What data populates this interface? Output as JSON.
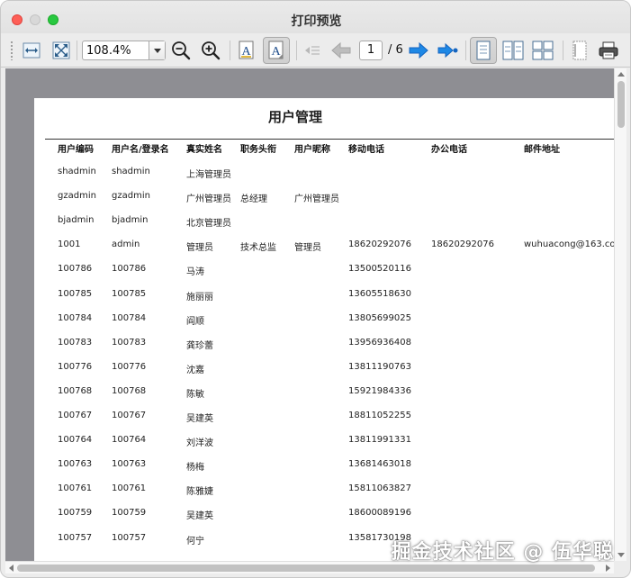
{
  "window": {
    "title": "打印预览"
  },
  "toolbar": {
    "zoom_value": "108.4%",
    "current_page": "1",
    "total_pages": "/ 6"
  },
  "document": {
    "title": "用户管理",
    "columns": [
      "用户编码",
      "用户名/登录名",
      "真实姓名",
      "职务头衔",
      "用户昵称",
      "移动电话",
      "办公电话",
      "邮件地址"
    ],
    "rows": [
      [
        "shadmin",
        "shadmin",
        "上海管理员",
        "",
        "",
        "",
        "",
        ""
      ],
      [
        "gzadmin",
        "gzadmin",
        "广州管理员",
        "总经理",
        "广州管理员",
        "",
        "",
        ""
      ],
      [
        "bjadmin",
        "bjadmin",
        "北京管理员",
        "",
        "",
        "",
        "",
        ""
      ],
      [
        "1001",
        "admin",
        "管理员",
        "技术总监",
        "管理员",
        "18620292076",
        "18620292076",
        "wuhuacong@163.co"
      ],
      [
        "100786",
        "100786",
        "马涛",
        "",
        "",
        "13500520116",
        "",
        ""
      ],
      [
        "100785",
        "100785",
        "施丽丽",
        "",
        "",
        "13605518630",
        "",
        ""
      ],
      [
        "100784",
        "100784",
        "阎顺",
        "",
        "",
        "13805699025",
        "",
        ""
      ],
      [
        "100783",
        "100783",
        "龚珍蕾",
        "",
        "",
        "13956936408",
        "",
        ""
      ],
      [
        "100776",
        "100776",
        "沈嘉",
        "",
        "",
        "13811190763",
        "",
        ""
      ],
      [
        "100768",
        "100768",
        "陈敏",
        "",
        "",
        "15921984336",
        "",
        ""
      ],
      [
        "100767",
        "100767",
        "吴建英",
        "",
        "",
        "18811052255",
        "",
        ""
      ],
      [
        "100764",
        "100764",
        "刘洋波",
        "",
        "",
        "13811991331",
        "",
        ""
      ],
      [
        "100763",
        "100763",
        "杨梅",
        "",
        "",
        "13681463018",
        "",
        ""
      ],
      [
        "100761",
        "100761",
        "陈雅婕",
        "",
        "",
        "15811063827",
        "",
        ""
      ],
      [
        "100759",
        "100759",
        "吴建英",
        "",
        "",
        "18600089196",
        "",
        ""
      ],
      [
        "100757",
        "100757",
        "何宁",
        "",
        "",
        "13581730198",
        "",
        ""
      ]
    ]
  },
  "watermark": "掘金技术社区 @ 伍华聪",
  "colors": {
    "close": "#fe5f57",
    "minimize": "#d8d8d8",
    "maximize": "#28c840",
    "arrow": "#1e88e5"
  }
}
